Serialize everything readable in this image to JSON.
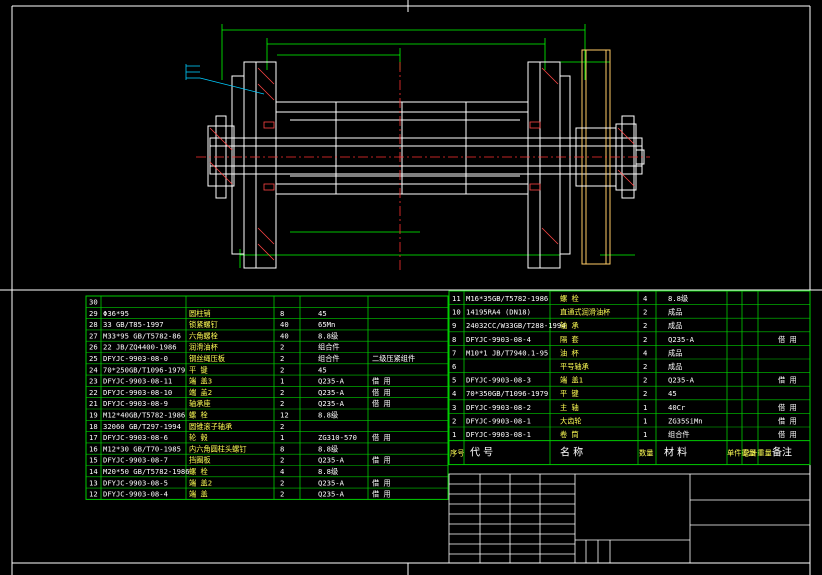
{
  "drawing": {
    "title": "Winch drum assembly drawing",
    "colors": {
      "background": "#000000",
      "outline": "#ffffff",
      "table_line": "#00cc00",
      "dimension": "#00ff00",
      "part": "#ffffff",
      "centerline": "#ff3030",
      "gear": "#ffcc66",
      "hatch": "#ff4444",
      "callout": "#00ccff"
    }
  },
  "bom_left": {
    "rows": [
      {
        "no": "30",
        "code": "",
        "name": "",
        "qty": "",
        "material": "",
        "note": ""
      },
      {
        "no": "29",
        "code": "Φ36*95",
        "name": "圆柱销",
        "qty": "8",
        "material": "45",
        "note": ""
      },
      {
        "no": "28",
        "code": "33 GB/T85-1997",
        "name": "锁紧螺钉",
        "qty": "40",
        "material": "65Mn",
        "note": ""
      },
      {
        "no": "27",
        "code": "M33*95 GB/T5782-86",
        "name": "六角螺栓",
        "qty": "40",
        "material": "8.8级",
        "note": ""
      },
      {
        "no": "26",
        "code": "22 JB/ZQ4400-1986",
        "name": "润滑油杯",
        "qty": "2",
        "material": "组合件",
        "note": ""
      },
      {
        "no": "25",
        "code": "DFYJC-9903-08-0",
        "name": "钢丝绳压板",
        "qty": "2",
        "material": "组合件",
        "note": "二级压紧组件"
      },
      {
        "no": "24",
        "code": "70*250GB/T1096-1979",
        "name": "平  键",
        "qty": "2",
        "material": "45",
        "note": ""
      },
      {
        "no": "23",
        "code": "DFYJC-9903-08-11",
        "name": "端  盖3",
        "qty": "1",
        "material": "Q235-A",
        "note": "借  用"
      },
      {
        "no": "22",
        "code": "DFYJC-9903-08-10",
        "name": "端  盖2",
        "qty": "2",
        "material": "Q235-A",
        "note": "借  用"
      },
      {
        "no": "21",
        "code": "DFYJC-9903-08-9",
        "name": "轴承座",
        "qty": "2",
        "material": "Q235-A",
        "note": "借  用"
      },
      {
        "no": "19",
        "code": "M12*40GB/T5782-1986",
        "name": "螺  栓",
        "qty": "12",
        "material": "8.8级",
        "note": ""
      },
      {
        "no": "18",
        "code": "32060 GB/T297-1994",
        "name": "圆锥滚子轴承",
        "qty": "2",
        "material": "",
        "note": ""
      },
      {
        "no": "17",
        "code": "DFYJC-9903-08-6",
        "name": "轮  毂",
        "qty": "1",
        "material": "ZG310-570",
        "note": "借  用"
      },
      {
        "no": "16",
        "code": "M12*30 GB/T70-1985",
        "name": "内六角圆柱头螺钉",
        "qty": "8",
        "material": "8.8级",
        "note": ""
      },
      {
        "no": "15",
        "code": "DFYJC-9903-08-7",
        "name": "挡圈板",
        "qty": "2",
        "material": "Q235-A",
        "note": "借  用"
      },
      {
        "no": "14",
        "code": "M20*50 GB/T5782-1986",
        "name": "螺  栓",
        "qty": "4",
        "material": "8.8级",
        "note": ""
      },
      {
        "no": "13",
        "code": "DFYJC-9903-08-5",
        "name": "端  盖2",
        "qty": "2",
        "material": "Q235-A",
        "note": "借  用"
      },
      {
        "no": "12",
        "code": "DFYJC-9903-08-4",
        "name": "端  盖",
        "qty": "2",
        "material": "Q235-A",
        "note": "借  用"
      }
    ]
  },
  "bom_right": {
    "rows": [
      {
        "no": "11",
        "code": "M16*35GB/T5782-1986",
        "name": "螺  栓",
        "qty": "4",
        "material": "8.8级",
        "unit_wt": "",
        "total_wt": "",
        "note": ""
      },
      {
        "no": "10",
        "code": "14195RA4 (DN18)",
        "name": "直通式润滑油杯",
        "qty": "2",
        "material": "成品",
        "unit_wt": "",
        "total_wt": "",
        "note": ""
      },
      {
        "no": "9",
        "code": "24032CC/W33GB/T288-1994",
        "name": "轴  承",
        "qty": "2",
        "material": "成品",
        "unit_wt": "",
        "total_wt": "",
        "note": ""
      },
      {
        "no": "8",
        "code": "DFYJC-9903-08-4",
        "name": "隔  套",
        "qty": "2",
        "material": "Q235-A",
        "unit_wt": "",
        "total_wt": "",
        "note": "借  用"
      },
      {
        "no": "7",
        "code": "M10*1 JB/T7940.1-95",
        "name": "油  杯",
        "qty": "4",
        "material": "成品",
        "unit_wt": "",
        "total_wt": "",
        "note": ""
      },
      {
        "no": "6",
        "code": "",
        "name": "平号轴承",
        "qty": "2",
        "material": "成品",
        "unit_wt": "",
        "total_wt": "",
        "note": ""
      },
      {
        "no": "5",
        "code": "DFYJC-9903-08-3",
        "name": "端  盖1",
        "qty": "2",
        "material": "Q235-A",
        "unit_wt": "",
        "total_wt": "",
        "note": "借  用"
      },
      {
        "no": "4",
        "code": "70*350GB/T1096-1979",
        "name": "平  键",
        "qty": "2",
        "material": "45",
        "unit_wt": "",
        "total_wt": "",
        "note": ""
      },
      {
        "no": "3",
        "code": "DFYJC-9903-08-2",
        "name": "主  轴",
        "qty": "1",
        "material": "40Cr",
        "unit_wt": "",
        "total_wt": "",
        "note": "借  用"
      },
      {
        "no": "2",
        "code": "DFYJC-9903-08-1",
        "name": "大齿轮",
        "qty": "1",
        "material": "ZG35SiMn",
        "unit_wt": "",
        "total_wt": "",
        "note": "借  用"
      },
      {
        "no": "1",
        "code": "DFYJC-9903-08-1",
        "name": "卷  筒",
        "qty": "1",
        "material": "组合件",
        "unit_wt": "",
        "total_wt": "",
        "note": "借  用"
      }
    ],
    "header": {
      "no": "序号",
      "code": "代      号",
      "name": "名      称",
      "qty": "数量",
      "material": "材    料",
      "unit_wt": "单件重量",
      "total_wt": "总计重量",
      "note": "备注"
    }
  }
}
